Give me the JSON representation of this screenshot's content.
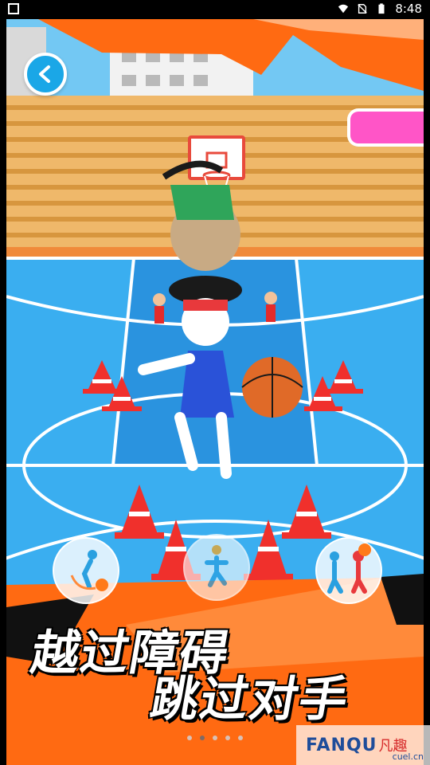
{
  "status_bar": {
    "time": "8:48"
  },
  "slogan": {
    "line1": "越过障碍",
    "line2": "跳过对手"
  },
  "carousel": {
    "page_count": 5,
    "active_index": 1
  },
  "watermark": {
    "brand": "FANQU",
    "cn": "凡趣",
    "domain": "cuel.cn"
  },
  "icons": [
    "back-icon",
    "dribble-icon",
    "jump-icon",
    "fake-icon"
  ],
  "colors": {
    "orange": "#ff6a12",
    "court_blue": "#3aaef0",
    "back_button": "#1aa7e7",
    "badge": "#ff55c7"
  }
}
